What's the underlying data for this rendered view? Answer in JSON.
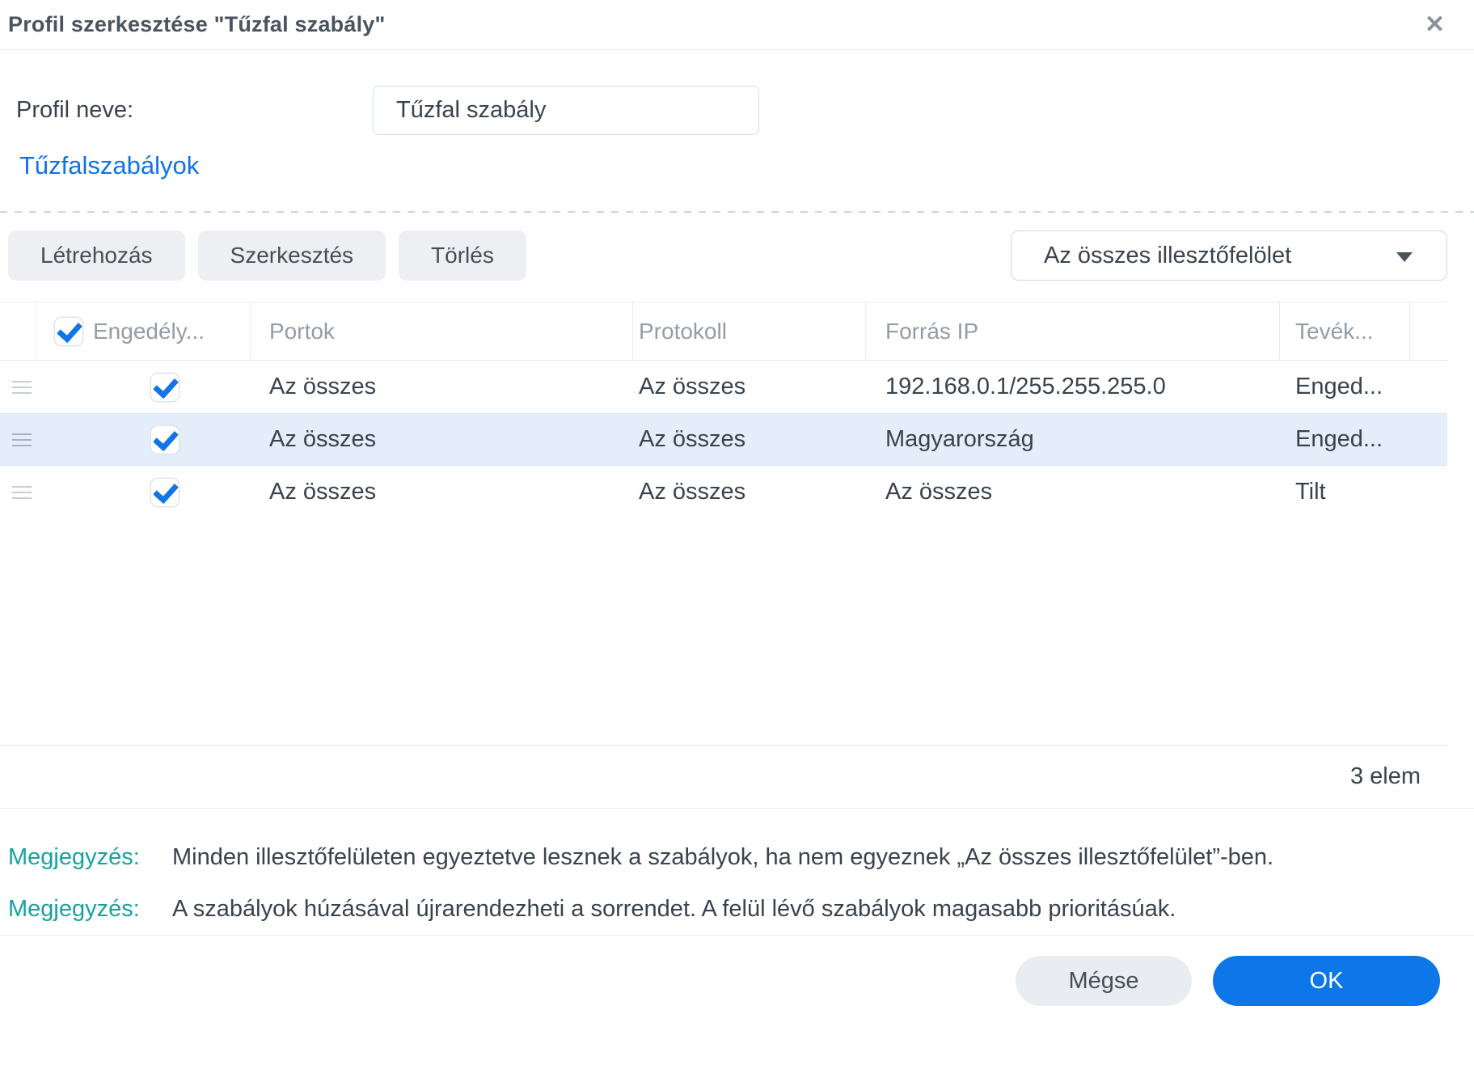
{
  "dialog": {
    "title": "Profil szerkesztése \"Tűzfal szabály\"",
    "close_icon": "✕"
  },
  "profile": {
    "label": "Profil neve:",
    "value": "Tűzfal szabály"
  },
  "section_heading": "Tűzfalszabályok",
  "toolbar": {
    "create_label": "Létrehozás",
    "edit_label": "Szerkesztés",
    "delete_label": "Törlés",
    "interface_dropdown": {
      "selected": "Az összes illesztőfelölet",
      "caret_icon": "caret-down"
    }
  },
  "table": {
    "columns": {
      "enabled": "Engedély...",
      "ports": "Portok",
      "protocol": "Protokoll",
      "source_ip": "Forrás IP",
      "action": "Tevék..."
    },
    "rows": [
      {
        "checked": true,
        "selected": false,
        "ports": "Az összes",
        "protocol": "Az összes",
        "source_ip": "192.168.0.1/255.255.255.0",
        "action": "Enged..."
      },
      {
        "checked": true,
        "selected": true,
        "ports": "Az összes",
        "protocol": "Az összes",
        "source_ip": "Magyarország",
        "action": "Enged..."
      },
      {
        "checked": true,
        "selected": false,
        "ports": "Az összes",
        "protocol": "Az összes",
        "source_ip": "Az összes",
        "action": "Tilt"
      }
    ],
    "count_label": "3 elem"
  },
  "notes": [
    {
      "label": "Megjegyzés:",
      "text": "Minden illesztőfelületen egyeztetve lesznek a szabályok, ha nem egyeznek „Az összes illesztőfelület”-ben."
    },
    {
      "label": "Megjegyzés:",
      "text": "A szabályok húzásával újrarendezheti a sorrendet. A felül lévő szabályok magasabb prioritásúak."
    }
  ],
  "footer": {
    "cancel_label": "Mégse",
    "ok_label": "OK"
  },
  "colors": {
    "accent_blue": "#0d76e8",
    "heading_blue": "#1173e6",
    "teal": "#16a2a0",
    "row_highlight": "#e4eefa"
  }
}
